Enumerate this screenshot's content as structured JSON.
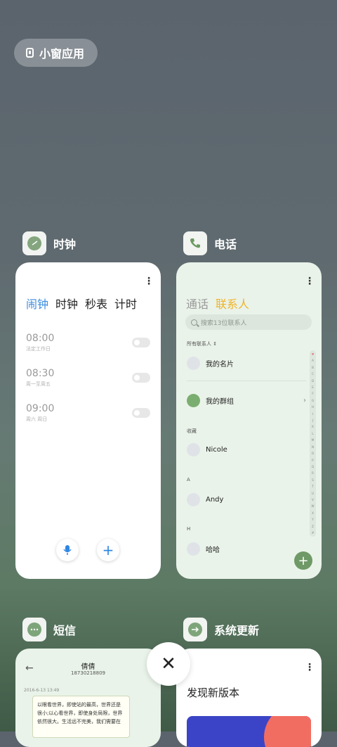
{
  "floating_window_button": {
    "label": "小窗应用",
    "icon": "floating-window-icon"
  },
  "apps": {
    "clock": {
      "name": "时钟",
      "icon": "clock-icon"
    },
    "phone": {
      "name": "电话",
      "icon": "phone-icon"
    },
    "sms": {
      "name": "短信",
      "icon": "message-icon"
    },
    "update": {
      "name": "系统更新",
      "icon": "update-icon"
    }
  },
  "clock_card": {
    "tabs": [
      "闹钟",
      "时钟",
      "秒表",
      "计时"
    ],
    "active_tab": "闹钟",
    "alarms": [
      {
        "time": "08:00",
        "repeat": "法定工作日",
        "enabled": false
      },
      {
        "time": "08:30",
        "repeat": "周一至周五",
        "enabled": false
      },
      {
        "time": "09:00",
        "repeat": "周六 周日",
        "enabled": false
      }
    ],
    "accent_color": "#3b8de0"
  },
  "phone_card": {
    "tabs": [
      "通话",
      "联系人"
    ],
    "active_tab": "联系人",
    "search_placeholder": "搜索13位联系人",
    "section_all": "所有联系人",
    "my_card": "我的名片",
    "my_groups": "我的群组",
    "section_favorites": "收藏",
    "contacts": [
      {
        "header": "收藏",
        "name": "Nicole"
      },
      {
        "header": "A",
        "name": "Andy"
      },
      {
        "header": "H",
        "name": "哈哈"
      }
    ],
    "accent_color": "#f0b429",
    "fab_color": "#6f9966"
  },
  "sms_card": {
    "contact_name": "倩倩",
    "contact_number": "18730218809",
    "date": "2016-6-13 13:49",
    "message": "以眼看世界，即使站的最高，世界还是很小;以心看世界，即使身处局限，世界依然很大。生活远不完美，我们需要在"
  },
  "update_card": {
    "title": "发现新版本"
  }
}
